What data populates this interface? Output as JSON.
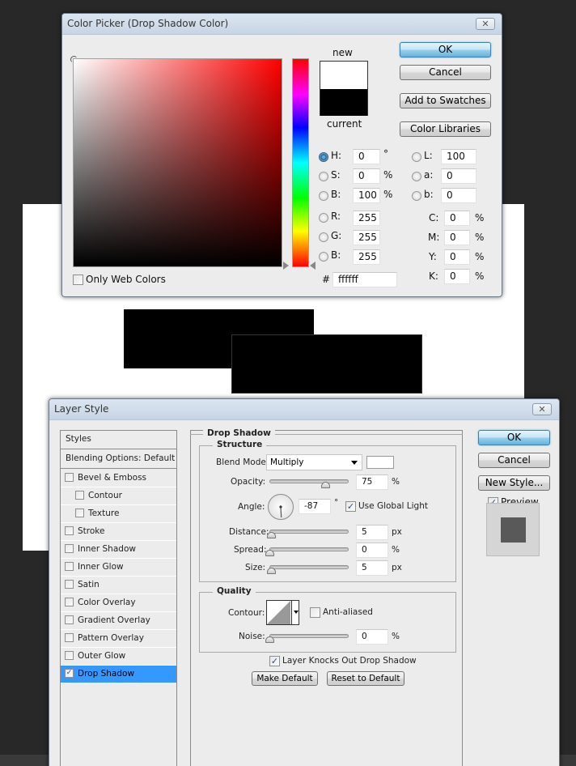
{
  "color_picker": {
    "title": "Color Picker (Drop Shadow Color)",
    "close_icon": "close-icon",
    "new_label": "new",
    "current_label": "current",
    "new_color": "#ffffff",
    "current_color": "#000000",
    "buttons": {
      "ok": "OK",
      "cancel": "Cancel",
      "add_to_swatches": "Add to Swatches",
      "color_libraries": "Color Libraries"
    },
    "only_web_colors": {
      "label": "Only Web Colors",
      "checked": false
    },
    "hsb": [
      {
        "label": "H:",
        "value": "0",
        "unit": "°",
        "selected": true
      },
      {
        "label": "S:",
        "value": "0",
        "unit": "%",
        "selected": false
      },
      {
        "label": "B:",
        "value": "100",
        "unit": "%",
        "selected": false
      }
    ],
    "lab": [
      {
        "label": "L:",
        "value": "100"
      },
      {
        "label": "a:",
        "value": "0"
      },
      {
        "label": "b:",
        "value": "0"
      }
    ],
    "rgb": [
      {
        "label": "R:",
        "value": "255"
      },
      {
        "label": "G:",
        "value": "255"
      },
      {
        "label": "B:",
        "value": "255"
      }
    ],
    "cmyk": [
      {
        "label": "C:",
        "value": "0",
        "unit": "%"
      },
      {
        "label": "M:",
        "value": "0",
        "unit": "%"
      },
      {
        "label": "Y:",
        "value": "0",
        "unit": "%"
      },
      {
        "label": "K:",
        "value": "0",
        "unit": "%"
      }
    ],
    "hex": {
      "label": "#",
      "value": "ffffff"
    },
    "hue_color": "#ff0000"
  },
  "layer_style": {
    "title": "Layer Style",
    "close_icon": "close-icon",
    "styles_header": "Styles",
    "blending_options": "Blending Options: Default",
    "effects": [
      {
        "label": "Bevel & Emboss",
        "checked": false,
        "indent": false,
        "selected": false
      },
      {
        "label": "Contour",
        "checked": false,
        "indent": true,
        "selected": false
      },
      {
        "label": "Texture",
        "checked": false,
        "indent": true,
        "selected": false
      },
      {
        "label": "Stroke",
        "checked": false,
        "indent": false,
        "selected": false
      },
      {
        "label": "Inner Shadow",
        "checked": false,
        "indent": false,
        "selected": false
      },
      {
        "label": "Inner Glow",
        "checked": false,
        "indent": false,
        "selected": false
      },
      {
        "label": "Satin",
        "checked": false,
        "indent": false,
        "selected": false
      },
      {
        "label": "Color Overlay",
        "checked": false,
        "indent": false,
        "selected": false
      },
      {
        "label": "Gradient Overlay",
        "checked": false,
        "indent": false,
        "selected": false
      },
      {
        "label": "Pattern Overlay",
        "checked": false,
        "indent": false,
        "selected": false
      },
      {
        "label": "Outer Glow",
        "checked": false,
        "indent": false,
        "selected": false
      },
      {
        "label": "Drop Shadow",
        "checked": true,
        "indent": false,
        "selected": true
      }
    ],
    "drop_shadow": {
      "section_title": "Drop Shadow",
      "structure_title": "Structure",
      "blend_mode_label": "Blend Mode:",
      "blend_mode_value": "Multiply",
      "shadow_color": "#ffffff",
      "opacity": {
        "label": "Opacity:",
        "value": "75",
        "unit": "%",
        "fraction": 0.75
      },
      "angle": {
        "label": "Angle:",
        "value": "-87",
        "unit": "°",
        "degrees": -87
      },
      "use_global_light": {
        "label": "Use Global Light",
        "checked": true
      },
      "distance": {
        "label": "Distance:",
        "value": "5",
        "unit": "px",
        "fraction": 0.02
      },
      "spread": {
        "label": "Spread:",
        "value": "0",
        "unit": "%",
        "fraction": 0
      },
      "size": {
        "label": "Size:",
        "value": "5",
        "unit": "px",
        "fraction": 0.02
      },
      "quality_title": "Quality",
      "contour_label": "Contour:",
      "anti_aliased": {
        "label": "Anti-aliased",
        "checked": false
      },
      "noise": {
        "label": "Noise:",
        "value": "0",
        "unit": "%",
        "fraction": 0
      },
      "layer_knocks_out": {
        "label": "Layer Knocks Out Drop Shadow",
        "checked": true
      },
      "make_default": "Make Default",
      "reset_to_default": "Reset to Default"
    },
    "buttons": {
      "ok": "OK",
      "cancel": "Cancel",
      "new_style": "New Style..."
    },
    "preview": {
      "label": "Preview",
      "checked": true
    }
  }
}
